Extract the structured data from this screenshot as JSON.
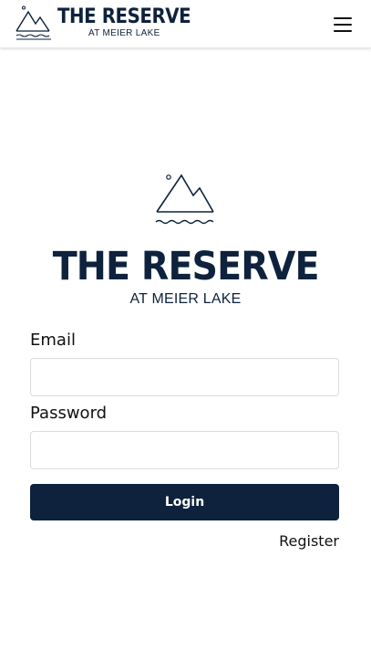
{
  "header": {
    "logo_title": "THE RESERVE",
    "logo_subtitle": "AT MEIER LAKE",
    "menu_icon": "hamburger-menu-icon"
  },
  "hero": {
    "title": "THE RESERVE",
    "subtitle": "AT MEIER LAKE",
    "logo_icon": "mountain-lake-icon"
  },
  "form": {
    "email_label": "Email",
    "email_value": "",
    "email_placeholder": "",
    "password_label": "Password",
    "password_value": "",
    "password_placeholder": "",
    "login_label": "Login",
    "register_label": "Register"
  },
  "colors": {
    "brand_navy": "#0e223d",
    "background": "#ffffff",
    "input_border": "#dcdcdc"
  }
}
